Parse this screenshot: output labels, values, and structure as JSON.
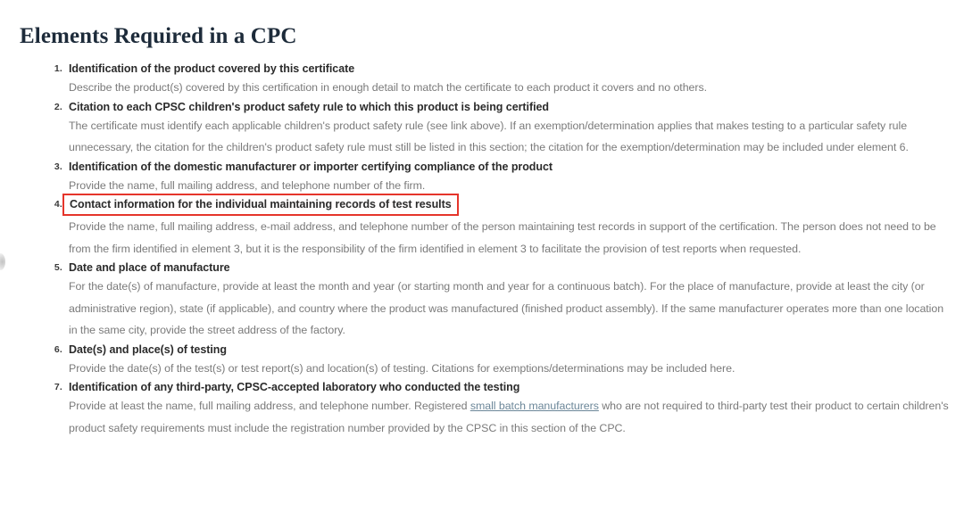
{
  "document": {
    "title": "Elements Required in a CPC"
  },
  "annotation": {
    "highlight_color": "#e5342a",
    "highlighted_item_number": "4."
  },
  "colors": {
    "title": "#1d2b3a",
    "heading": "#2b2b2b",
    "body": "#7a7a7a",
    "link": "#6c8799",
    "annotation_red": "#e5342a",
    "background": "#ffffff"
  },
  "elements": [
    {
      "number": "1.",
      "heading": "Identification of the product covered by this certificate",
      "body": "Describe the product(s) covered by this certification in enough detail to match the certificate to each product it covers and no others.",
      "highlighted": false
    },
    {
      "number": "2.",
      "heading": "Citation to each CPSC children's product safety rule to which this product is being certified",
      "body": "The certificate must identify each applicable children's product safety rule (see link above). If an exemption/determination applies that makes testing to a particular safety rule unnecessary, the citation for the children's product safety rule must still be listed in this section; the citation for the exemption/determination may be included under element 6.",
      "highlighted": false
    },
    {
      "number": "3.",
      "heading": "Identification of the domestic manufacturer or importer certifying compliance of the product",
      "body": "Provide the name, full mailing address, and telephone number of the firm.",
      "highlighted": false
    },
    {
      "number": "4.",
      "heading": "Contact information for the individual maintaining records of test results",
      "body": "Provide the name, full mailing address, e-mail address, and telephone number of the person maintaining test records in support of the certification. The person does not need to be from the firm identified in element 3, but it is the responsibility of the firm identified in element 3 to facilitate the provision of test reports when requested.",
      "highlighted": true
    },
    {
      "number": "5.",
      "heading": "Date and place of manufacture",
      "body": "For the date(s) of manufacture, provide at least the month and year (or starting month and year for a continuous batch). For the place of manufacture, provide at least the city (or administrative region), state (if applicable), and country where the product was manufactured (finished product assembly). If the same manufacturer operates more than one location in the same city, provide the street address of the factory.",
      "highlighted": false
    },
    {
      "number": "6.",
      "heading": "Date(s) and place(s) of testing",
      "body": "Provide the date(s) of the test(s) or test report(s) and location(s) of testing. Citations for exemptions/determinations may be included here.",
      "highlighted": false
    },
    {
      "number": "7.",
      "heading": "Identification of any third-party, CPSC-accepted laboratory who conducted the testing",
      "body_before_link": "Provide at least the name, full mailing address, and telephone number. Registered ",
      "body_link": "small batch manufacturers",
      "body_after_link": " who are not required to third-party test their product to certain children's product safety requirements must include the registration number provided by the CPSC in this section of the CPC.",
      "highlighted": false
    }
  ]
}
